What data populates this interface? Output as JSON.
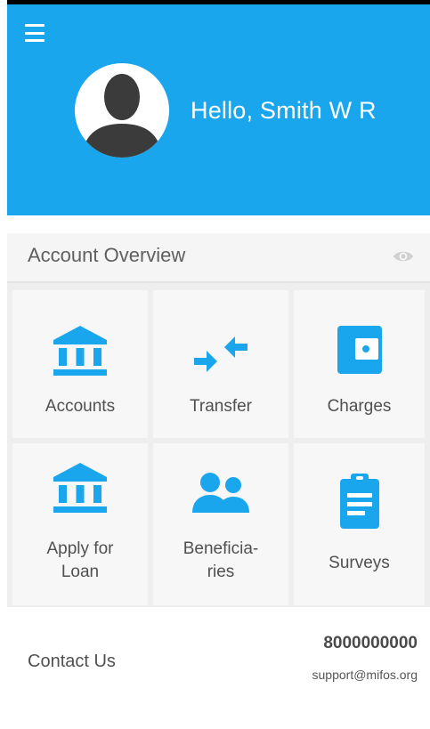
{
  "header": {
    "greeting": "Hello, Smith W R"
  },
  "overview": {
    "title": "Account Overview"
  },
  "tiles": [
    {
      "label": "Accounts"
    },
    {
      "label": "Transfer"
    },
    {
      "label": "Charges"
    },
    {
      "label": "Apply for\nLoan"
    },
    {
      "label": "Beneficia-\nries"
    },
    {
      "label": "Surveys"
    }
  ],
  "footer": {
    "contact_label": "Contact Us",
    "phone": "8000000000",
    "email": "support@mifos.org"
  },
  "colors": {
    "primary": "#1aa6ed",
    "icon": "#1aa6ed"
  }
}
